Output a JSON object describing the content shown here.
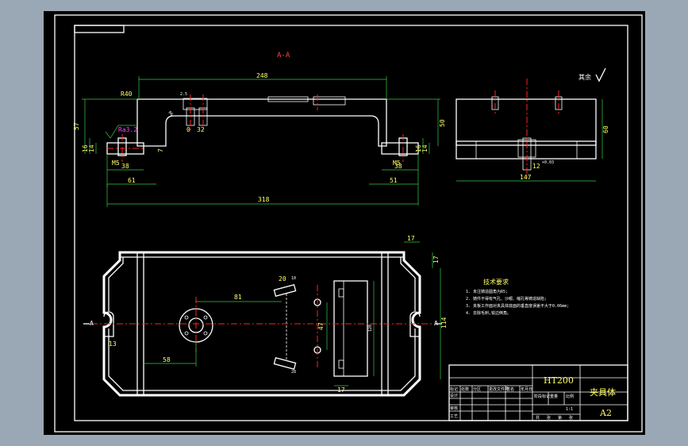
{
  "section_label": "A-A",
  "dims_section": {
    "d248": "248",
    "d57": "57",
    "d50": "50",
    "d14l": "14",
    "d16l": "16",
    "d14r": "14",
    "d16r": "16",
    "d7": "7",
    "d38l": "38",
    "d38r": "38",
    "d61l": "61",
    "d51r": "51",
    "d318": "318",
    "m5l": "M5",
    "m5r": "M5",
    "d32": "32",
    "r40": "R40",
    "r6": "R6",
    "d25": "2.5",
    "d0": "0"
  },
  "roughness": {
    "left": "Ra3.2",
    "corner_label": "其余"
  },
  "dims_side": {
    "d60": "60",
    "d147": "147",
    "d12": "12",
    "tol": "+0.03"
  },
  "dims_plan": {
    "d17a": "17",
    "d17b": "17",
    "d81": "81",
    "d58": "58",
    "d114": "114",
    "d13": "13",
    "d20": "20",
    "d17c": "17",
    "d47": "47",
    "d120": "120",
    "d28": "28",
    "d10": "10",
    "aa": "A"
  },
  "tech": {
    "heading": "技术要求",
    "items": [
      "1. 未注铸造圆角为R5;",
      "2. 铸件不得有气孔、沙眼、缩孔等铸造缺陷;",
      "3. 夹板工作面对夹具体底面的垂直度误差不大于0.06mm;",
      "4. 去除毛刺,锐边倒角。"
    ]
  },
  "title_block": {
    "material": "HT200",
    "part_name": "夹具体",
    "scale": "A2",
    "ratio": "1:1",
    "row_labels": [
      "标记",
      "设计",
      "审核",
      "工艺"
    ],
    "col_labels": [
      "处数",
      "分区",
      "更改文件号",
      "签名",
      "年月日"
    ],
    "stage_labels": [
      "阶段标记",
      "重量",
      "比例"
    ],
    "sheet_labels": [
      "共",
      "张",
      "第",
      "张"
    ]
  }
}
